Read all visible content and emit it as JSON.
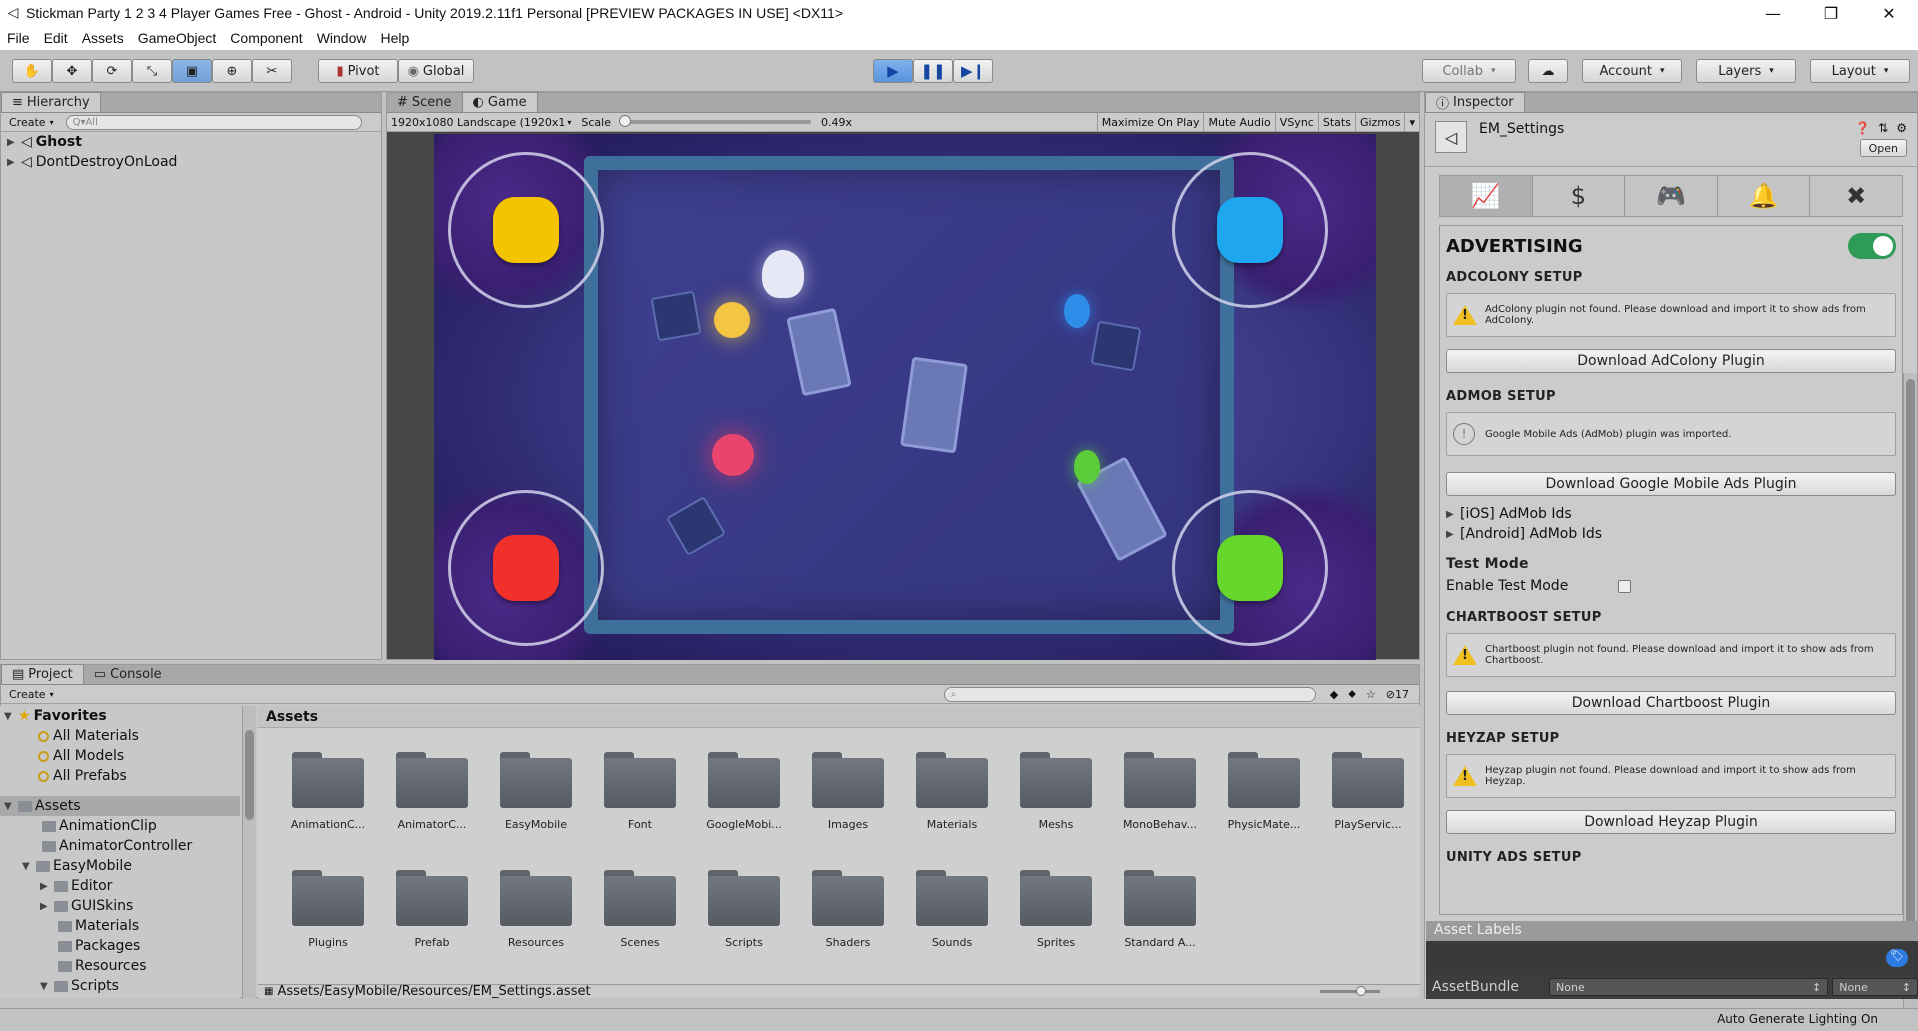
{
  "window": {
    "title": "Stickman Party 1 2 3 4 Player Games Free - Ghost - Android - Unity 2019.2.11f1 Personal [PREVIEW PACKAGES IN USE] <DX11>",
    "unity_icon": "unity-logo-icon"
  },
  "menu": [
    "File",
    "Edit",
    "Assets",
    "GameObject",
    "Component",
    "Window",
    "Help"
  ],
  "toolbar": {
    "pivot": "Pivot",
    "global": "Global",
    "collab": "Collab",
    "account": "Account",
    "layers": "Layers",
    "layout": "Layout"
  },
  "hierarchy": {
    "tab": "Hierarchy",
    "create": "Create",
    "search_placeholder": "Q▾All",
    "items": [
      "Ghost",
      "DontDestroyOnLoad"
    ]
  },
  "scene_tab": "Scene",
  "game": {
    "tab": "Game",
    "resolution": "1920x1080 Landscape (1920x1",
    "scale_label": "Scale",
    "scale_value": "0.49x",
    "buttons": [
      "Maximize On Play",
      "Mute Audio",
      "VSync",
      "Stats",
      "Gizmos"
    ],
    "joysticks": [
      {
        "name": "yellow",
        "color": "#f5c400"
      },
      {
        "name": "blue",
        "color": "#1ea7ef"
      },
      {
        "name": "red",
        "color": "#f0312b"
      },
      {
        "name": "green",
        "color": "#66d72b"
      }
    ]
  },
  "project": {
    "tab": "Project",
    "console_tab": "Console",
    "create": "Create",
    "count": "17",
    "favorites": {
      "label": "Favorites",
      "items": [
        "All Materials",
        "All Models",
        "All Prefabs"
      ]
    },
    "assets_label": "Assets",
    "tree": [
      {
        "label": "AnimationClip",
        "indent": 2
      },
      {
        "label": "AnimatorController",
        "indent": 2
      },
      {
        "label": "EasyMobile",
        "indent": 2,
        "open": true
      },
      {
        "label": "Editor",
        "indent": 3,
        "arrow": true
      },
      {
        "label": "GUISkins",
        "indent": 3,
        "arrow": true
      },
      {
        "label": "Materials",
        "indent": 3
      },
      {
        "label": "Packages",
        "indent": 3
      },
      {
        "label": "Resources",
        "indent": 3
      },
      {
        "label": "Scripts",
        "indent": 3,
        "open": true
      }
    ],
    "folders_row1": [
      "AnimationC...",
      "AnimatorC...",
      "EasyMobile",
      "Font",
      "GoogleMobi...",
      "Images",
      "Materials",
      "Meshs",
      "MonoBehav...",
      "PhysicMate...",
      "PlayServic..."
    ],
    "folders_row2": [
      "Plugins",
      "Prefab",
      "Resources",
      "Scenes",
      "Scripts",
      "Shaders",
      "Sounds",
      "Sprites",
      "Standard A..."
    ],
    "path": "Assets/EasyMobile/Resources/EM_Settings.asset"
  },
  "inspector": {
    "tab": "Inspector",
    "object_name": "EM_Settings",
    "open_btn": "Open",
    "advertising": "ADVERTISING",
    "adcolony": {
      "title": "ADCOLONY SETUP",
      "msg": "AdColony plugin not found. Please download and import it to show ads from AdColony.",
      "btn": "Download AdColony Plugin"
    },
    "admob": {
      "title": "ADMOB SETUP",
      "msg": "Google Mobile Ads (AdMob) plugin was imported.",
      "btn": "Download Google Mobile Ads Plugin",
      "ios": "[iOS] AdMob Ids",
      "android": "[Android] AdMob Ids"
    },
    "testmode": {
      "title": "Test Mode",
      "label": "Enable Test Mode"
    },
    "chartboost": {
      "title": "CHARTBOOST SETUP",
      "msg": "Chartboost plugin not found. Please download and import it to show ads from Chartboost.",
      "btn": "Download Chartboost Plugin"
    },
    "heyzap": {
      "title": "HEYZAP SETUP",
      "msg": "Heyzap plugin not found. Please download and import it to show ads from Heyzap.",
      "btn": "Download Heyzap Plugin"
    },
    "unityads": {
      "title": "UNITY ADS SETUP"
    },
    "asset_labels": "Asset Labels",
    "asset_bundle": "AssetBundle",
    "none1": "None",
    "none2": "None"
  },
  "status": {
    "right": "Auto Generate Lighting On"
  }
}
